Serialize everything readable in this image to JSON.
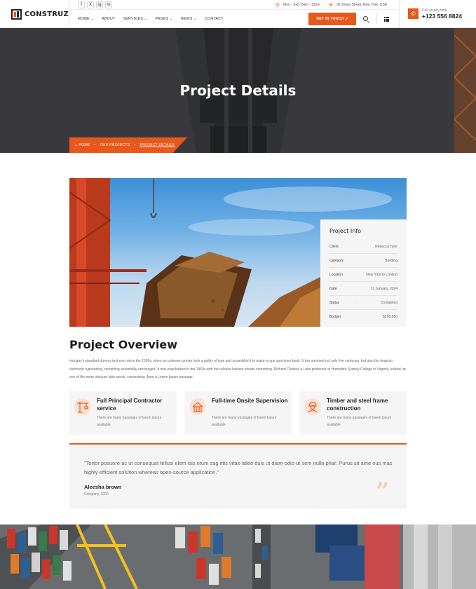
{
  "header": {
    "logo": "CONSTRUZ",
    "social": [
      "f",
      "X",
      "ig",
      "in"
    ],
    "hours": "Mon - Sat / 8am - 12pm",
    "address": "98 Jones Street, New York, USA",
    "nav": [
      "HOME ⌄",
      "ABOUT",
      "SERVICES ⌄",
      "PAGES ⌄",
      "NEWS ⌄",
      "CONTACT"
    ],
    "cta": "GET IN TOUCH ↗",
    "call_label": "Call us any time",
    "call_number": "+123 556 8824"
  },
  "hero": {
    "title": "Project Details",
    "breadcrumb": [
      "HOME",
      "OUR PROJECTS",
      "PROJECT DETAILS"
    ]
  },
  "project_info": {
    "title": "Project Info",
    "rows": [
      {
        "key": "Client",
        "value": "Rebecca Tylor"
      },
      {
        "key": "Category",
        "value": "Building"
      },
      {
        "key": "Location",
        "value": "New York to London"
      },
      {
        "key": "Date",
        "value": "12 January, 2024"
      },
      {
        "key": "Status",
        "value": "Completed"
      },
      {
        "key": "Budget",
        "value": "$200,560"
      }
    ]
  },
  "overview": {
    "title": "Project Overview",
    "text": "Industry's standard dummy text ever since the 1500s, when an unknown printer took a galley of type and scrambled it to make a type specimen book. It has survived not only five centuries, but also the leapinto electronic typesetting, remaining essentially unchanged. It was popularised in the 1960s with the release letraset sheets containing. Richard Clintock a Latin professor at Hampden-Sydney College in Virginia, looked up one of the more obscure latin words, consectetur, from a Lorem Ipsum passage."
  },
  "features": [
    {
      "title": "Full Principal Contractor service",
      "desc": "There are many passages of lorem ipsum available"
    },
    {
      "title": "Full-time Onsite Supervision",
      "desc": "There are many passages of lorem ipsum available"
    },
    {
      "title": "Timber and steel frame construction",
      "desc": "There are many passages of lorem ipsum available"
    }
  ],
  "quote": {
    "text": "\"Tortor posuere ac ut consequat tellusi elem isis etum sag ittis vitae atleo duis ut diam odio ut sem nulla phar. Purus sit ame nus mas highly efficient solution whereas open-source application.\"",
    "author": "Aleesha brown",
    "role": "Company, CEO"
  },
  "colors": {
    "accent": "#e8581a",
    "card": "#f5f5f5"
  }
}
